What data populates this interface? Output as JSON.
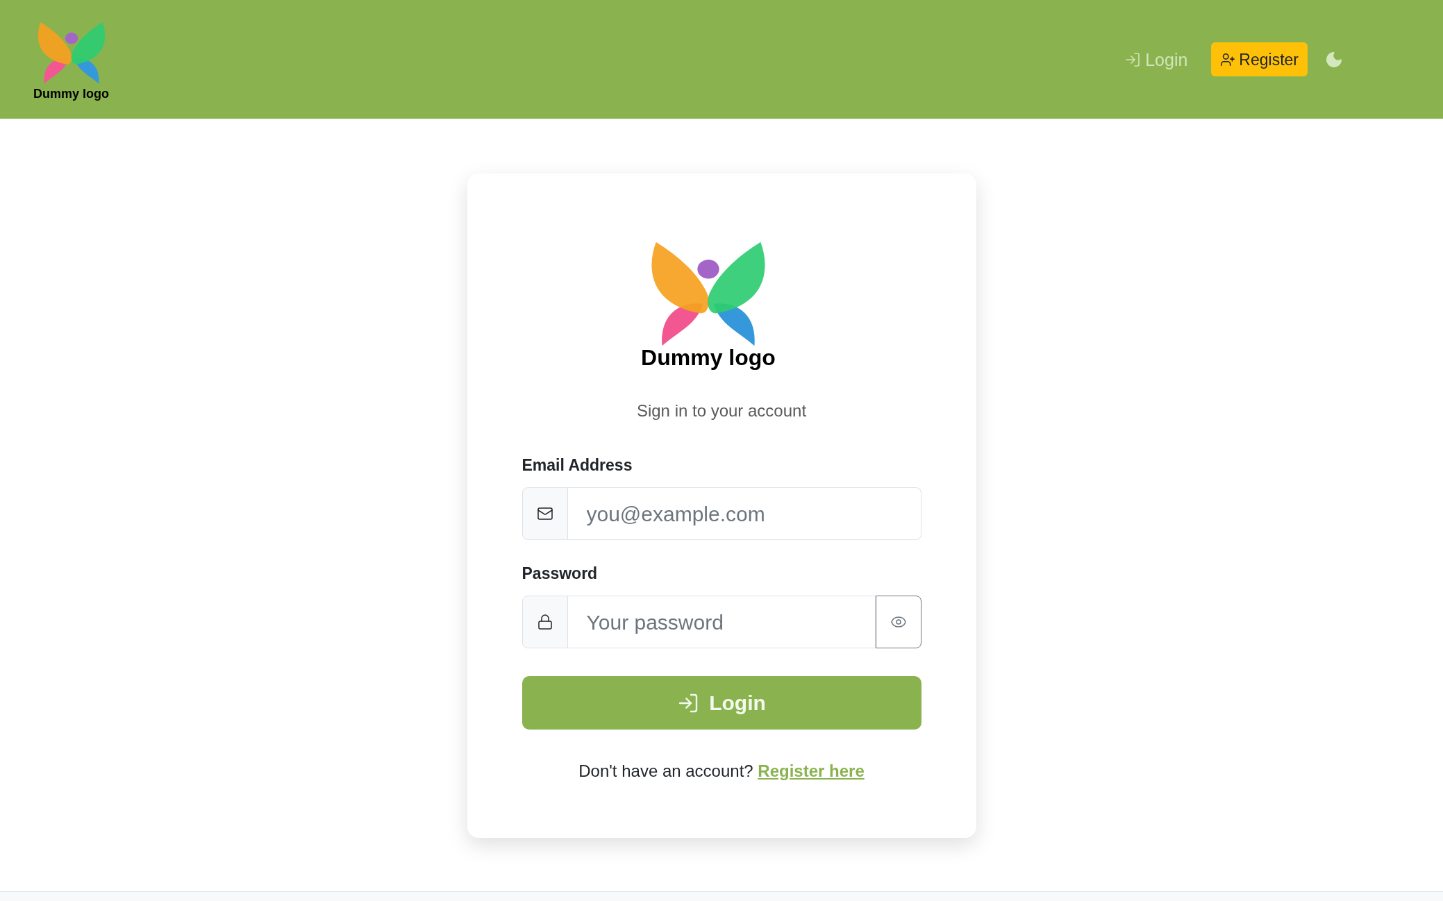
{
  "header": {
    "logo": {
      "text": "Dummy logo"
    },
    "nav": [
      {
        "kind": "link",
        "label": "Login"
      },
      {
        "kind": "button",
        "label": "Register"
      }
    ]
  },
  "login_card": {
    "logo": {
      "text": "Dummy logo"
    },
    "subtitle": "Sign in to your account",
    "fields": [
      {
        "kind": "email",
        "label": "Email Address",
        "placeholder": "you@example.com"
      },
      {
        "kind": "password",
        "label": "Password",
        "placeholder": "Your password"
      }
    ],
    "submit": {
      "label": "Login"
    },
    "register_prompt": {
      "text": "Don't have an account?",
      "link": "Register here"
    }
  }
}
